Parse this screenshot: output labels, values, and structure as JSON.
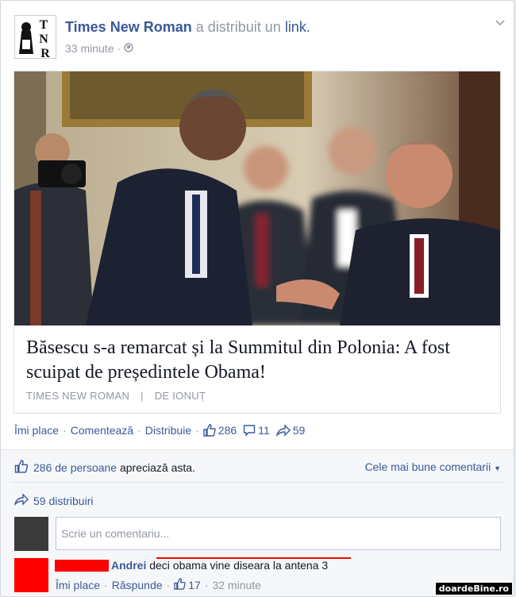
{
  "post": {
    "page_name": "Times New Roman",
    "shared_text": "a distribuit un",
    "link_word": "link.",
    "time": "33 minute",
    "visibility_icon": "globe-icon",
    "menu_icon": "chevron-down-icon",
    "avatar_letters": [
      "T",
      "N",
      "R"
    ]
  },
  "link": {
    "headline": "Băsescu s-a remarcat și la Summitul din Polonia: A fost scuipat de președintele Obama!",
    "source": "TIMES NEW ROMAN",
    "author": "DE IONUȚ",
    "source_sep": "|"
  },
  "actions": {
    "like": "Îmi place",
    "comment": "Comentează",
    "share": "Distribuie",
    "like_count": "286",
    "comment_count": "11",
    "share_count": "59"
  },
  "ufi": {
    "likes_count_text": "286 de persoane",
    "likes_suffix": "apreciază asta.",
    "sort_label": "Cele mai bune comentarii",
    "shares_text": "59 distribuiri",
    "comment_placeholder": "Scrie un comentariu..."
  },
  "comment": {
    "author": "Andrei",
    "text": "deci obama vine diseara la antena 3",
    "like": "Îmi place",
    "reply": "Răspunde",
    "likes": "17",
    "time": "32 minute"
  },
  "watermark": "doardeBine.ro",
  "colors": {
    "link_blue": "#3b5998",
    "grey_text": "#9197a3",
    "redaction": "#ff0000"
  }
}
